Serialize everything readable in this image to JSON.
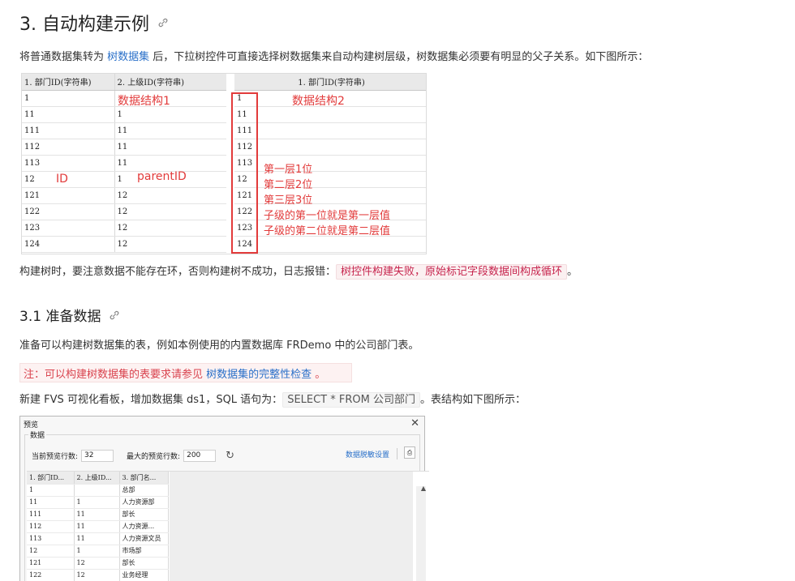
{
  "section": {
    "title": "3. 自动构建示例"
  },
  "intro": {
    "before": "将普通数据集转为 ",
    "link": "树数据集",
    "after": " 后，下拉树控件可直接选择树数据集来自动构建树层级，树数据集必须要有明显的父子关系。如下图所示："
  },
  "figure1": {
    "left_headers": [
      "1. 部门ID(字符串)",
      "2. 上级ID(字符串)"
    ],
    "left_rows": [
      [
        "1",
        ""
      ],
      [
        "11",
        "1"
      ],
      [
        "111",
        "11"
      ],
      [
        "112",
        "11"
      ],
      [
        "113",
        "11"
      ],
      [
        "12",
        "1"
      ],
      [
        "121",
        "12"
      ],
      [
        "122",
        "12"
      ],
      [
        "123",
        "12"
      ],
      [
        "124",
        "12"
      ]
    ],
    "right_header": "1. 部门ID(字符串)",
    "right_rows": [
      "1",
      "11",
      "111",
      "112",
      "113",
      "12",
      "121",
      "122",
      "123",
      "124"
    ],
    "annotations": {
      "struct1": "数据结构1",
      "struct2": "数据结构2",
      "id": "ID",
      "parent": "parentID",
      "l1": "第一层1位",
      "l2": "第二层2位",
      "l3": "第三层3位",
      "child1": "子级的第一位就是第一层值",
      "child2": "子级的第二位就是第二层值"
    }
  },
  "warn": {
    "before": "构建树时，要注意数据不能存在环，否则构建树不成功，日志报错：",
    "code": "树控件构建失败，原始标记字段数据间构成循环",
    "after": "。"
  },
  "subsection": {
    "title": "3.1 准备数据"
  },
  "prep": {
    "text": "准备可以构建树数据集的表，例如本例使用的内置数据库 FRDemo 中的公司部门表。"
  },
  "note": {
    "before": "注：可以构建树数据集的表要求请参见 ",
    "link": "树数据集的完整性检查",
    "after": " 。"
  },
  "create": {
    "before": "新建 FVS 可视化看板，增加数据集 ds1，SQL 语句为：",
    "code": "SELECT * FROM 公司部门",
    "after": "。表结构如下图所示："
  },
  "dialog": {
    "title": "预览",
    "group": "数据",
    "current_rows_label": "当前预览行数:",
    "current_rows": "32",
    "max_rows_label": "最大的预览行数:",
    "max_rows": "200",
    "link": "数据脱敏设置",
    "headers": [
      "1. 部门ID...",
      "2. 上级ID...",
      "3. 部门名..."
    ],
    "rows": [
      [
        "1",
        "",
        "总部"
      ],
      [
        "11",
        "1",
        "人力资源部"
      ],
      [
        "111",
        "11",
        "部长"
      ],
      [
        "112",
        "11",
        "人力资源..."
      ],
      [
        "113",
        "11",
        "人力资源文员"
      ],
      [
        "12",
        "1",
        "市场部"
      ],
      [
        "121",
        "12",
        "部长"
      ],
      [
        "122",
        "12",
        "业务经理"
      ]
    ]
  }
}
